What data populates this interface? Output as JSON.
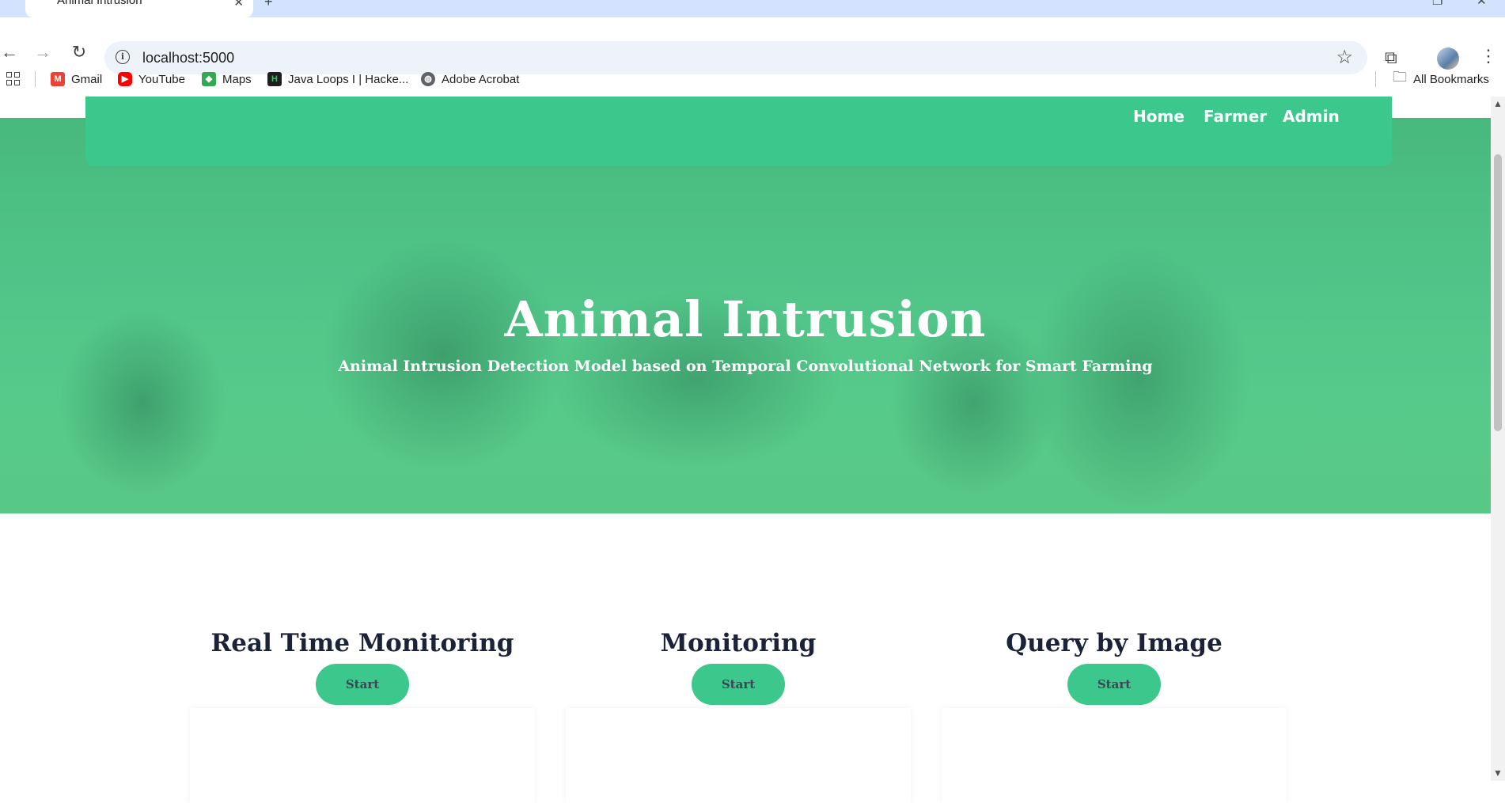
{
  "browser": {
    "tab_title": "Animal Intrusion",
    "url": "localhost:5000",
    "bookmarks": [
      {
        "label": "Gmail",
        "icon": "gmail-icon",
        "color": "#ea4335"
      },
      {
        "label": "YouTube",
        "icon": "youtube-icon",
        "color": "#ff0000"
      },
      {
        "label": "Maps",
        "icon": "maps-icon",
        "color": "#34a853"
      },
      {
        "label": "Java Loops I | Hacke...",
        "icon": "hackerrank-icon",
        "color": "#1e1e1e"
      },
      {
        "label": "Adobe Acrobat",
        "icon": "globe-icon",
        "color": "#5f6368"
      }
    ],
    "all_bookmarks": "All Bookmarks"
  },
  "site": {
    "nav": [
      "Home",
      "Farmer",
      "Admin"
    ],
    "hero_title": "Animal Intrusion",
    "hero_subtitle": "Animal Intrusion Detection Model based on Temporal Convolutional Network for Smart Farming",
    "services": [
      {
        "title": "Real Time Monitoring",
        "button": "Start"
      },
      {
        "title": "Monitoring",
        "button": "Start"
      },
      {
        "title": "Query by Image",
        "button": "Start"
      }
    ],
    "accent_color": "#3cc88d"
  }
}
